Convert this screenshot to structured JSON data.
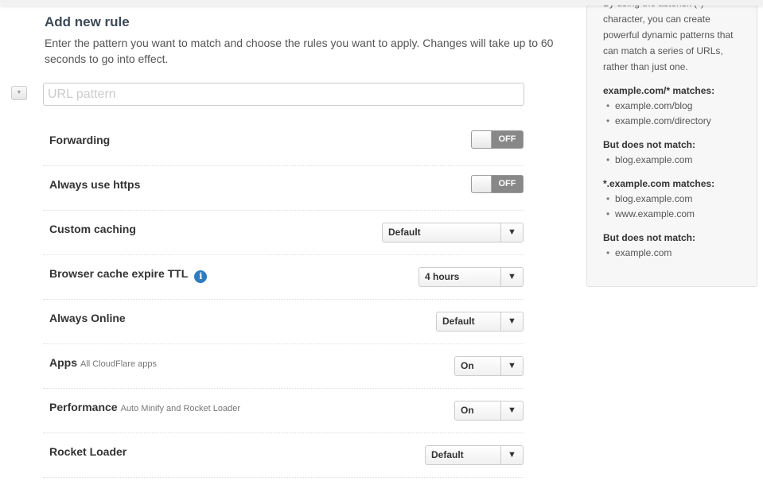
{
  "form": {
    "title": "Add new rule",
    "description": "Enter the pattern you want to match and choose the rules you want to apply. Changes will take up to 60 seconds to go into effect.",
    "url_placeholder": "URL pattern",
    "collapse_icon": "triangle-down-icon"
  },
  "rules": [
    {
      "label": "Forwarding",
      "sub": "",
      "control": "toggle",
      "value": "OFF"
    },
    {
      "label": "Always use https",
      "sub": "",
      "control": "toggle",
      "value": "OFF"
    },
    {
      "label": "Custom caching",
      "sub": "",
      "control": "select",
      "value": "Default"
    },
    {
      "label": "Browser cache expire TTL",
      "sub": "",
      "control": "select",
      "value": "4 hours",
      "info_icon": "i"
    },
    {
      "label": "Always Online",
      "sub": "",
      "control": "select",
      "value": "Default"
    },
    {
      "label": "Apps",
      "sub": "All CloudFlare apps",
      "control": "select",
      "value": "On"
    },
    {
      "label": "Performance",
      "sub": "Auto Minify and Rocket Loader",
      "control": "select",
      "value": "On"
    },
    {
      "label": "Rocket Loader",
      "sub": "",
      "control": "select",
      "value": "Default"
    }
  ],
  "select_arrow": "▼",
  "sidebar": {
    "intro": "By using the asterisk (*) character, you can create powerful dynamic patterns that can match a series of URLs, rather than just one.",
    "sections": [
      {
        "heading": "example.com/* matches:",
        "items": [
          "example.com/blog",
          "example.com/directory"
        ]
      },
      {
        "heading": "But does not match:",
        "items": [
          "blog.example.com"
        ]
      },
      {
        "heading": "*.example.com matches:",
        "items": [
          "blog.example.com",
          "www.example.com"
        ]
      },
      {
        "heading": "But does not match:",
        "items": [
          "example.com"
        ]
      }
    ]
  },
  "colors": {
    "info": "#2f7bbf",
    "heading": "#3d4a57",
    "toggle_off": "#888888"
  }
}
